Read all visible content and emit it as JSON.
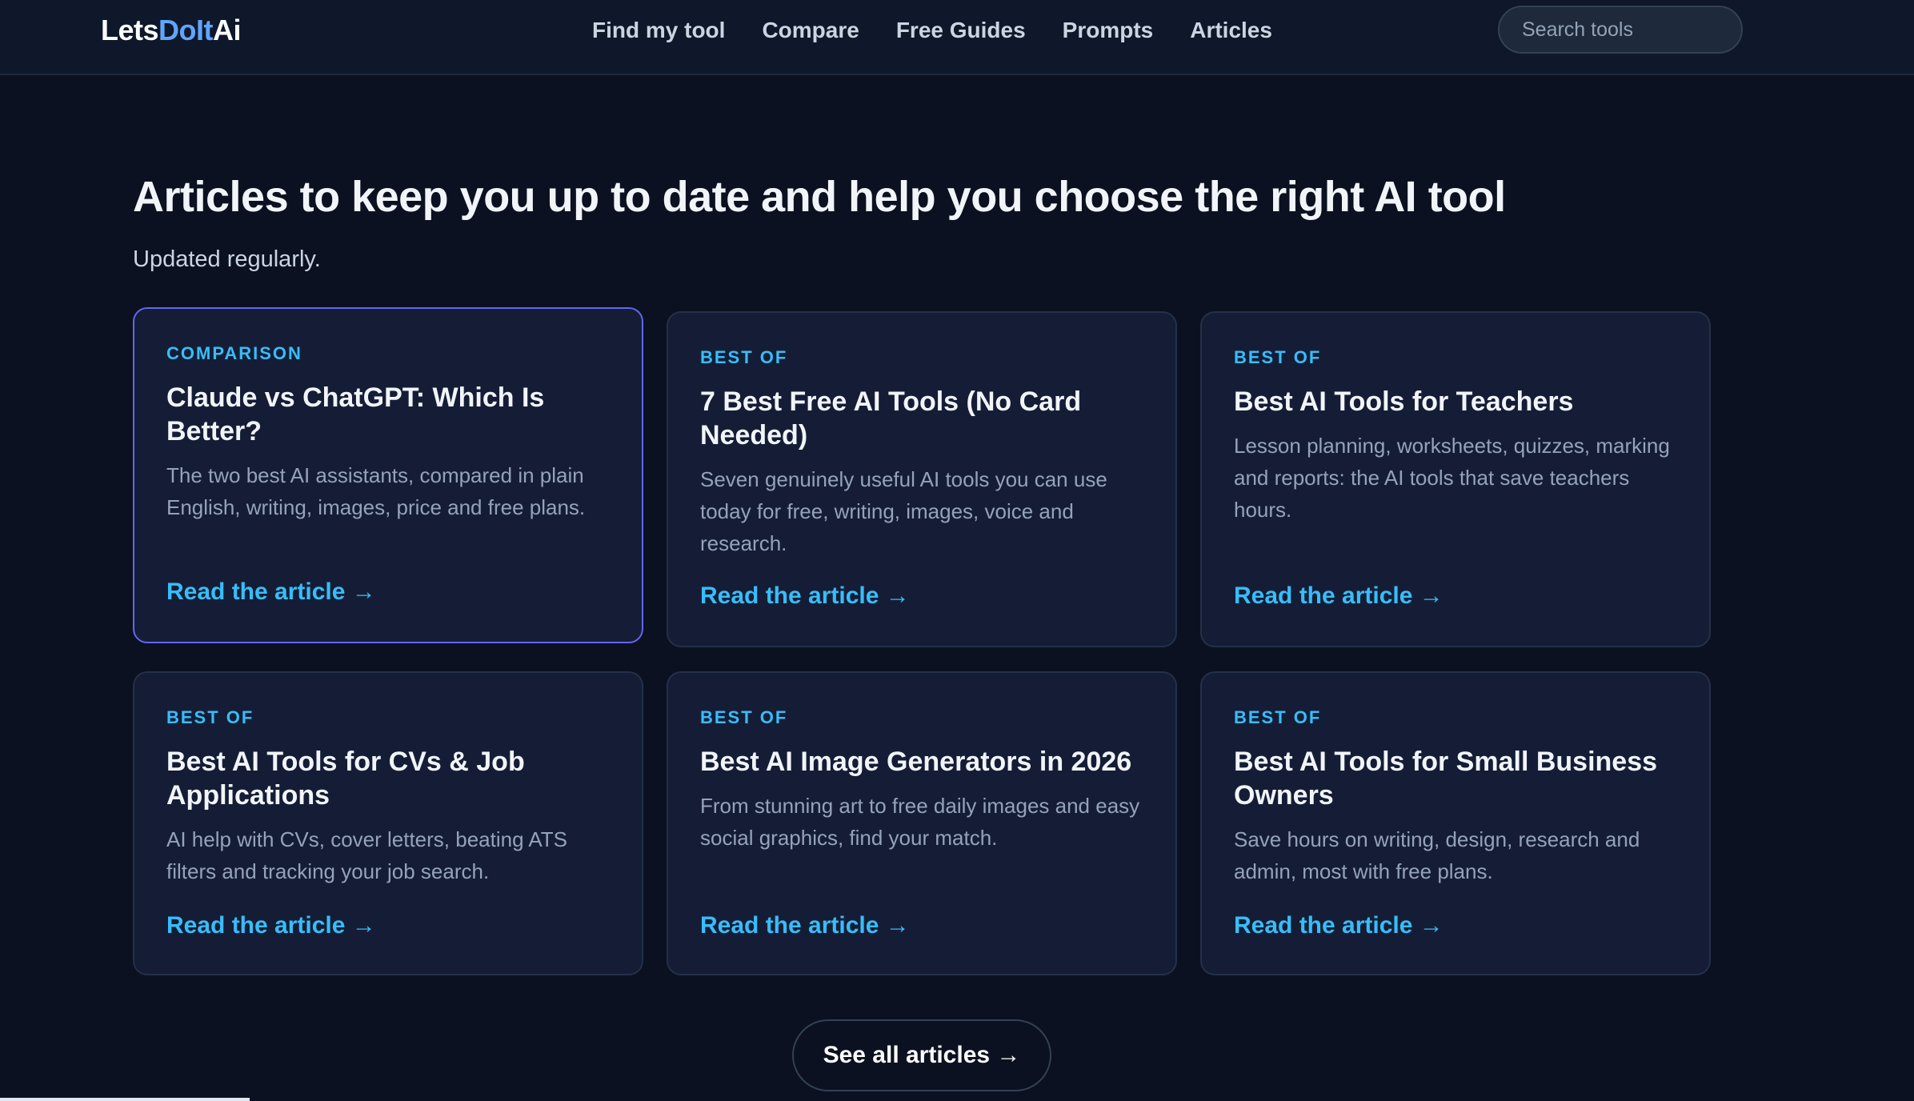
{
  "header": {
    "logo": {
      "part1": "Lets",
      "part2": "DoIt",
      "part3": "Ai"
    },
    "nav": [
      "Find my tool",
      "Compare",
      "Free Guides",
      "Prompts",
      "Articles"
    ],
    "search_placeholder": "Search tools"
  },
  "main": {
    "headline": "Articles to keep you up to date and help you choose the right AI tool",
    "subline": "Updated regularly.",
    "cards": [
      {
        "category": "COMPARISON",
        "title": "Claude vs ChatGPT: Which Is Better?",
        "description": "The two best AI assistants, compared in plain English, writing, images, price and free plans.",
        "cta": "Read the article →"
      },
      {
        "category": "BEST OF",
        "title": "7 Best Free AI Tools (No Card Needed)",
        "description": "Seven genuinely useful AI tools you can use today for free, writing, images, voice and research.",
        "cta": "Read the article →"
      },
      {
        "category": "BEST OF",
        "title": "Best AI Tools for Teachers",
        "description": "Lesson planning, worksheets, quizzes, marking and reports: the AI tools that save teachers hours.",
        "cta": "Read the article →"
      },
      {
        "category": "BEST OF",
        "title": "Best AI Tools for CVs & Job Applications",
        "description": "AI help with CVs, cover letters, beating ATS filters and tracking your job search.",
        "cta": "Read the article →"
      },
      {
        "category": "BEST OF",
        "title": "Best AI Image Generators in 2026",
        "description": "From stunning art to free daily images and easy social graphics, find your match.",
        "cta": "Read the article →"
      },
      {
        "category": "BEST OF",
        "title": "Best AI Tools for Small Business Owners",
        "description": "Save hours on writing, design, research and admin, most with free plans.",
        "cta": "Read the article →"
      }
    ],
    "see_all": "See all articles →"
  }
}
